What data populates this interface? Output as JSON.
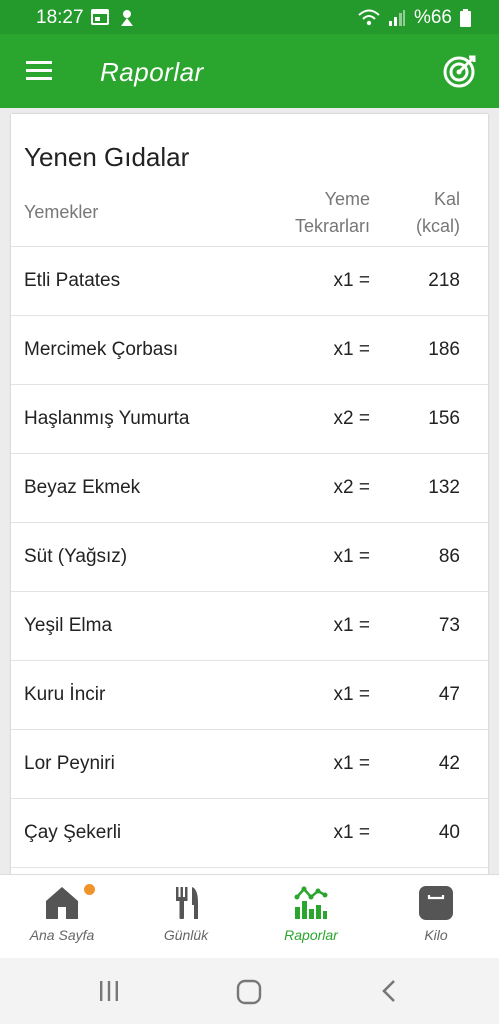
{
  "status": {
    "time": "18:27",
    "battery": "%66"
  },
  "appbar": {
    "title": "Raporlar"
  },
  "table": {
    "title": "Yenen Gıdalar",
    "headers": {
      "food": "Yemekler",
      "rep_line1": "Yeme",
      "rep_line2": "Tekrarları",
      "kcal_line1": "Kal",
      "kcal_line2": "(kcal)"
    },
    "rows": [
      {
        "name": "Etli Patates",
        "rep": "x1 =",
        "kcal": "218"
      },
      {
        "name": "Mercimek Çorbası",
        "rep": "x1 =",
        "kcal": "186"
      },
      {
        "name": "Haşlanmış Yumurta",
        "rep": "x2 =",
        "kcal": "156"
      },
      {
        "name": "Beyaz Ekmek",
        "rep": "x2 =",
        "kcal": "132"
      },
      {
        "name": "Süt (Yağsız)",
        "rep": "x1 =",
        "kcal": "86"
      },
      {
        "name": "Yeşil Elma",
        "rep": "x1 =",
        "kcal": "73"
      },
      {
        "name": "Kuru İncir",
        "rep": "x1 =",
        "kcal": "47"
      },
      {
        "name": "Lor Peyniri",
        "rep": "x1 =",
        "kcal": "42"
      },
      {
        "name": "Çay Şekerli",
        "rep": "x1 =",
        "kcal": "40"
      }
    ]
  },
  "nav": [
    {
      "label": "Ana Sayfa",
      "icon": "home-icon"
    },
    {
      "label": "Günlük",
      "icon": "fork-knife-icon"
    },
    {
      "label": "Raporlar",
      "icon": "chart-icon",
      "active": true
    },
    {
      "label": "Kilo",
      "icon": "scale-icon"
    }
  ],
  "colors": {
    "primary": "#2aa52d",
    "statusbar": "#239a2b",
    "badge": "#f0932b"
  }
}
